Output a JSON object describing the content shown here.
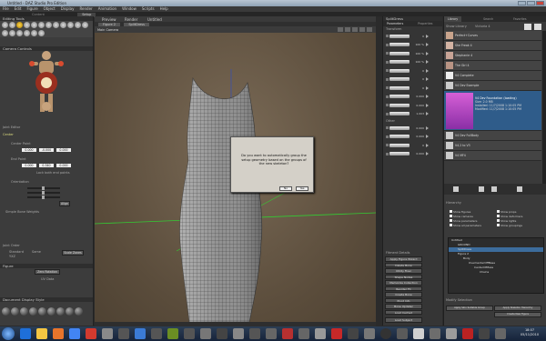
{
  "window": {
    "title": "Untitled - DAZ Studio Pro Edition"
  },
  "menu": [
    "File",
    "Edit",
    "Figure",
    "Object",
    "Display",
    "Render",
    "Animation",
    "Window",
    "Scripts",
    "Help"
  ],
  "top_tabs": [
    "Content",
    "Setup"
  ],
  "left": {
    "editing_tools": "Editing Tools",
    "camera_controls": "Camera Controls",
    "joint_editor": "Joint Editor",
    "center": "Center",
    "center_point": "Center Point",
    "center_vals": [
      "0.000",
      "-0.000",
      "0.000"
    ],
    "end_point": "End Point",
    "end_vals": [
      "0.000",
      "0.340",
      "0.000"
    ],
    "lock_label": "Lock both end points",
    "orientation": "Orientation",
    "align_btn": "Align",
    "simple_bone_weights": "Simple Bone Weights",
    "joint_order": "Joint Order",
    "order_opts": [
      "Standard",
      "Same"
    ],
    "order_val": "YXZ",
    "scale_btn": "Scale Zones",
    "figure": "Figure",
    "zero_btn": "Zero Rotation",
    "document_display": "Document Display Style",
    "uv_label": "UV Data"
  },
  "viewport": {
    "tabs": [
      "Preview",
      "Render",
      "Untitled"
    ],
    "figure_select": "Figure 2",
    "item_select": "SplitDress",
    "camera": "Main Camera"
  },
  "dialog": {
    "message": "Do you want to automatically group the setup geometry based on the groups of the new skeleton?",
    "no": "No",
    "yes": "Yes"
  },
  "params": {
    "header": "SplitDress",
    "tabs": [
      "Parameters",
      "Properties"
    ],
    "transform": "Transform",
    "rows": [
      {
        "label": "xRotate",
        "value": "0"
      },
      {
        "label": "yRotate",
        "value": "100 %"
      },
      {
        "label": "zRotate",
        "value": "100 %"
      },
      {
        "label": "Scale",
        "value": "100 %"
      },
      {
        "label": "xScale",
        "value": "0"
      },
      {
        "label": "yScale",
        "value": "0"
      },
      {
        "label": "zScale",
        "value": "0"
      },
      {
        "label": "xTran",
        "value": "0.000"
      },
      {
        "label": "yTran",
        "value": "0.000"
      },
      {
        "label": "zTran",
        "value": "1.003"
      },
      {
        "label": "Other",
        "value": "0.000"
      },
      {
        "label": "Crotch",
        "value": "0.000"
      },
      {
        "label": "Hip",
        "value": "0"
      },
      {
        "label": "Chest",
        "value": "0.000"
      }
    ],
    "other": "Other",
    "setup_details": "Fitment Details",
    "buttons": [
      "Apply Figure Wizard",
      "Delete Bone",
      "Utility Fixer",
      "Shape Nodes",
      "Memorize Collection",
      "Reorder FC",
      "Create Bone",
      "Pivot Info",
      "Bone Updater",
      "Load Cached"
    ],
    "last_btn": "Load Subject"
  },
  "library": {
    "tabs": [
      "Library",
      "Search",
      "Favorites"
    ],
    "show_library": "Show Library",
    "source": "Victoria 4",
    "items": [
      {
        "name": "Perfect+Curves",
        "color": "#c9a48c"
      },
      {
        "name": "She Freak 4",
        "color": "#d3b3a3"
      },
      {
        "name": "Stephanie 4",
        "color": "#c8a496"
      },
      {
        "name": "The Girl 4",
        "color": "#b99484"
      },
      {
        "name": "V4 Complete",
        "color": "#eee"
      },
      {
        "name": "V4 Dev Example",
        "color": "#ccc"
      }
    ],
    "selected": {
      "name": "V4 Dev Foundation (loading)",
      "size": "Size: 2.0 MB",
      "installed": "Installed: 11/7/2008 1:10:05 PM",
      "modified": "Modified: 11/7/2008 1:10:05 PM"
    },
    "items_after": [
      {
        "name": "V4 Dev FullBody",
        "color": "#ccc"
      },
      {
        "name": "V4.2 to V3",
        "color": "#ccc"
      },
      {
        "name": "V4 MF4",
        "color": "#ccc"
      }
    ],
    "hierarchy": "Hierarchy",
    "checks": [
      "Show figures",
      "Show props",
      "Show cameras",
      "Show deformers",
      "Show parameters",
      "Show lights",
      "Show all parameters",
      "Show groupings"
    ],
    "tree": [
      {
        "name": "Untitled",
        "depth": 0,
        "sel": false
      },
      {
        "name": "GROUND",
        "depth": 1,
        "sel": false
      },
      {
        "name": "SplitDress",
        "depth": 1,
        "sel": true
      },
      {
        "name": "Figure 2",
        "depth": 1,
        "sel": false
      },
      {
        "name": "Body",
        "depth": 2,
        "sel": false
      },
      {
        "name": "OverCenterOffBase",
        "depth": 3,
        "sel": false
      },
      {
        "name": "CenterOfMass",
        "depth": 4,
        "sel": false
      },
      {
        "name": "Chains",
        "depth": 5,
        "sel": false
      }
    ],
    "modify_selection": "Modify Selection",
    "sel_buttons": [
      "Apply Skin Suitable Group",
      "Apply Skeleton Hierarchy",
      "Create New Figure"
    ]
  },
  "taskbar": {
    "time": "18:07",
    "date": "05/11/2010"
  }
}
